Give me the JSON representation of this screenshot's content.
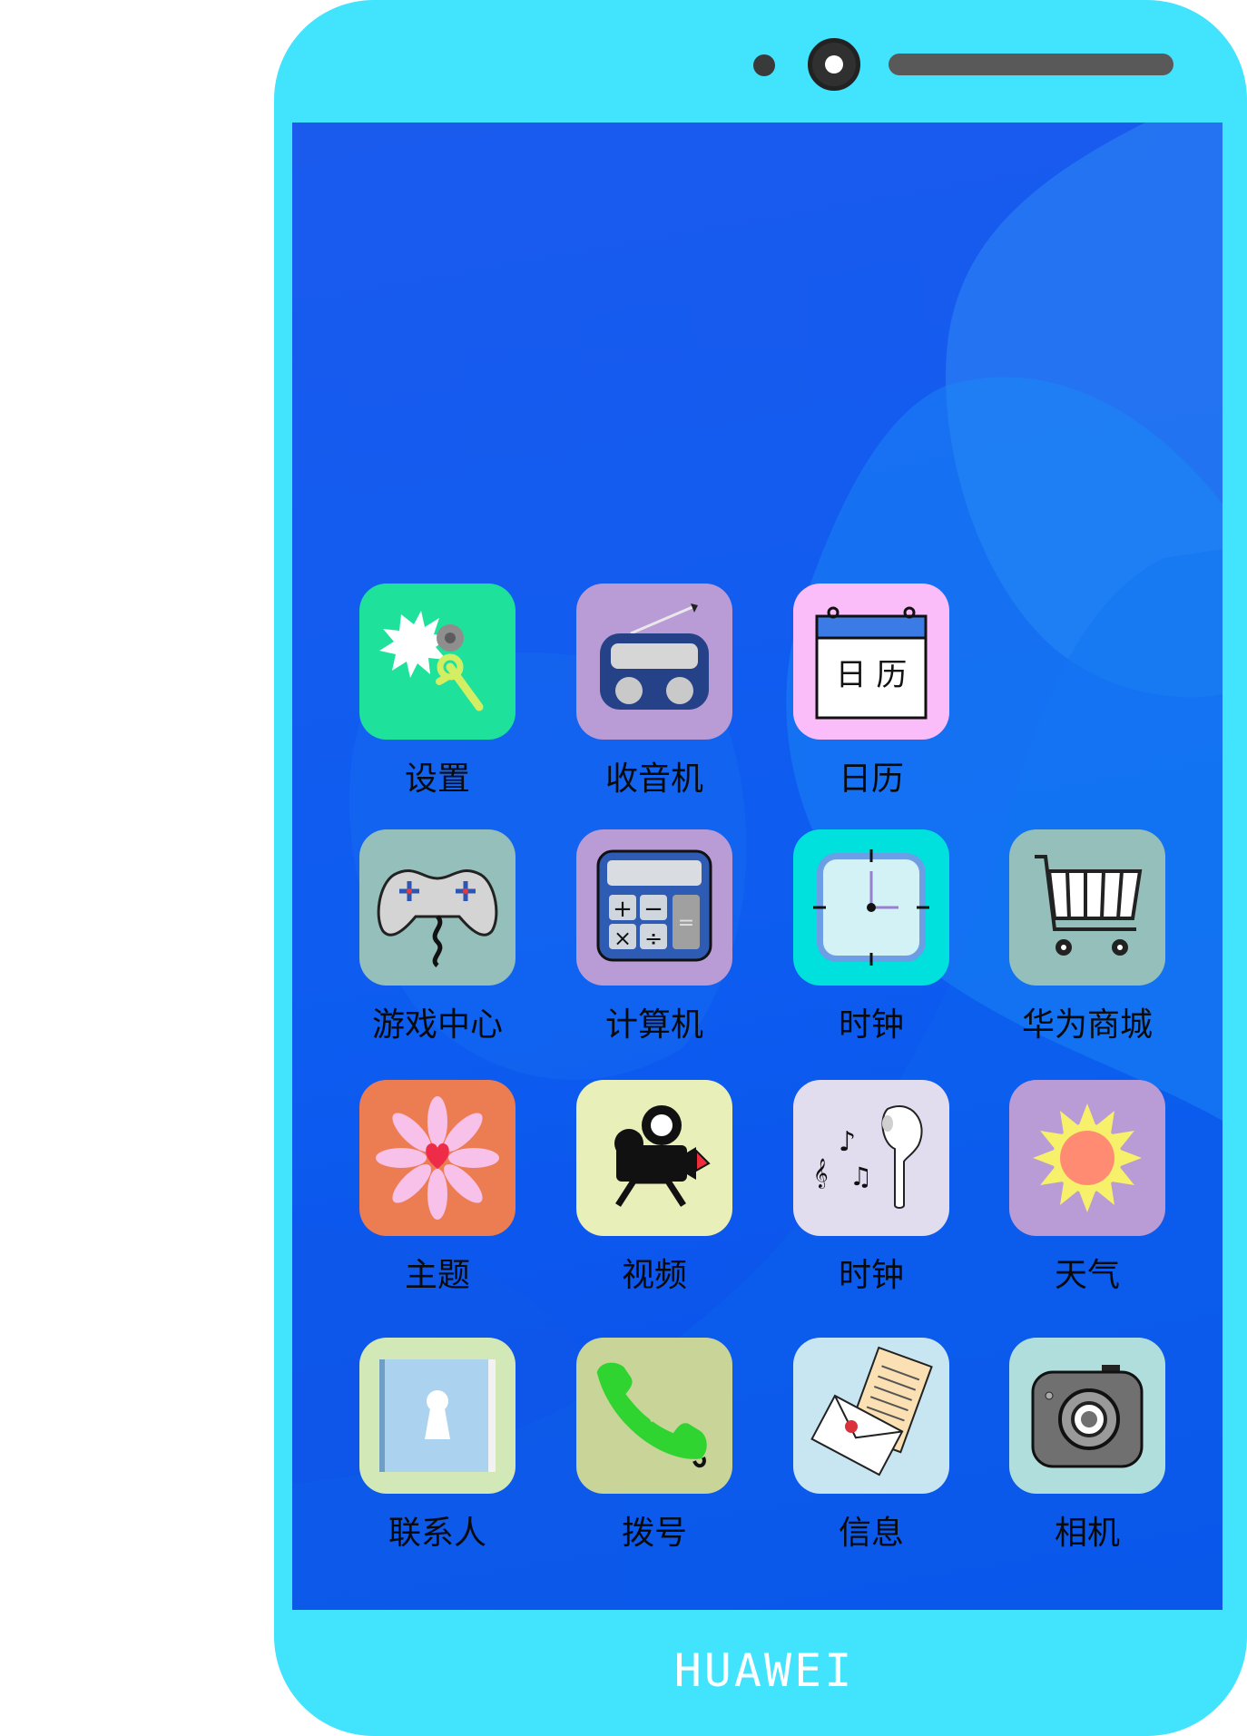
{
  "device": {
    "brand": "HUAWEI",
    "body_color": "#41e3fd",
    "screen_color": "#0d5cf0"
  },
  "home_screen": {
    "rows": [
      [
        {
          "label": "设置",
          "icon": "settings-gear-wand-icon",
          "tile_color": "#1ee29c"
        },
        {
          "label": "收音机",
          "icon": "radio-icon",
          "tile_color": "#b99bd6"
        },
        {
          "label": "日历",
          "icon": "calendar-icon",
          "tile_color": "#fbbdfa",
          "icon_text": "日 历"
        }
      ],
      [
        {
          "label": "游戏中心",
          "icon": "gamepad-icon",
          "tile_color": "#94bfba"
        },
        {
          "label": "计算机",
          "icon": "calculator-icon",
          "tile_color": "#b99bd6"
        },
        {
          "label": "时钟",
          "icon": "clock-icon",
          "tile_color": "#00e0dc"
        },
        {
          "label": "华为商城",
          "icon": "shopping-cart-icon",
          "tile_color": "#94bfba"
        }
      ],
      [
        {
          "label": "主题",
          "icon": "flower-icon",
          "tile_color": "#ec7c52"
        },
        {
          "label": "视频",
          "icon": "video-camera-icon",
          "tile_color": "#e8efb8"
        },
        {
          "label": "时钟",
          "icon": "earbud-music-icon",
          "tile_color": "#e2dcef"
        },
        {
          "label": "天气",
          "icon": "sun-icon",
          "tile_color": "#b99bd6"
        }
      ],
      [
        {
          "label": "联系人",
          "icon": "contacts-book-icon",
          "tile_color": "#d2e8b6"
        },
        {
          "label": "拨号",
          "icon": "phone-handset-icon",
          "tile_color": "#c8d498"
        },
        {
          "label": "信息",
          "icon": "envelope-letter-icon",
          "tile_color": "#c8e6f2"
        },
        {
          "label": "相机",
          "icon": "camera-icon",
          "tile_color": "#b0dedc"
        }
      ]
    ]
  }
}
